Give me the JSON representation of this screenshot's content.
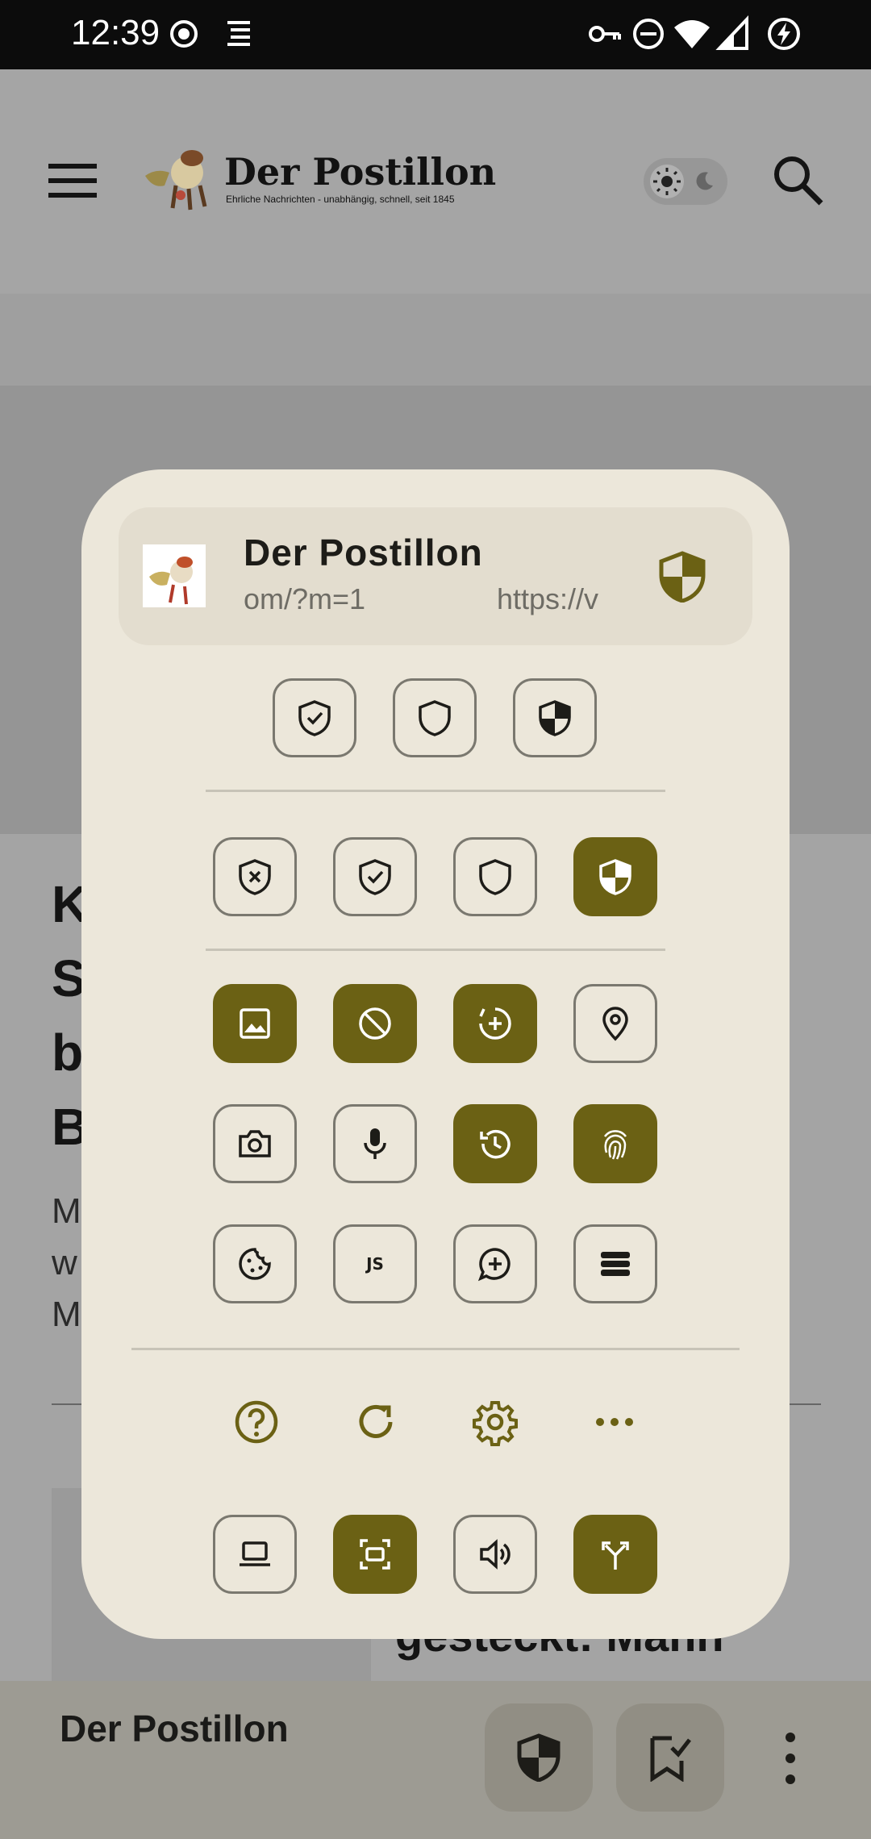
{
  "status_bar": {
    "time": "12:39"
  },
  "header": {
    "brand_name": "Der Postillon",
    "brand_tagline": "Ehrliche Nachrichten - unabhängig, schnell, seit 1845"
  },
  "article": {
    "title_fragment": "K\nS\nb\nB",
    "text_fragment": "M\nw\nM",
    "card_title_fragment": "gesteckt: Mann"
  },
  "dialog": {
    "site_title": "Der Postillon",
    "site_url_part1": "om/?m=1",
    "site_url_part2": "https://v"
  },
  "bottom_bar": {
    "title": "Der Postillon"
  },
  "colors": {
    "accent": "#6b6114",
    "dialog_bg": "#ece7da",
    "card_bg": "#e3ddcf"
  }
}
